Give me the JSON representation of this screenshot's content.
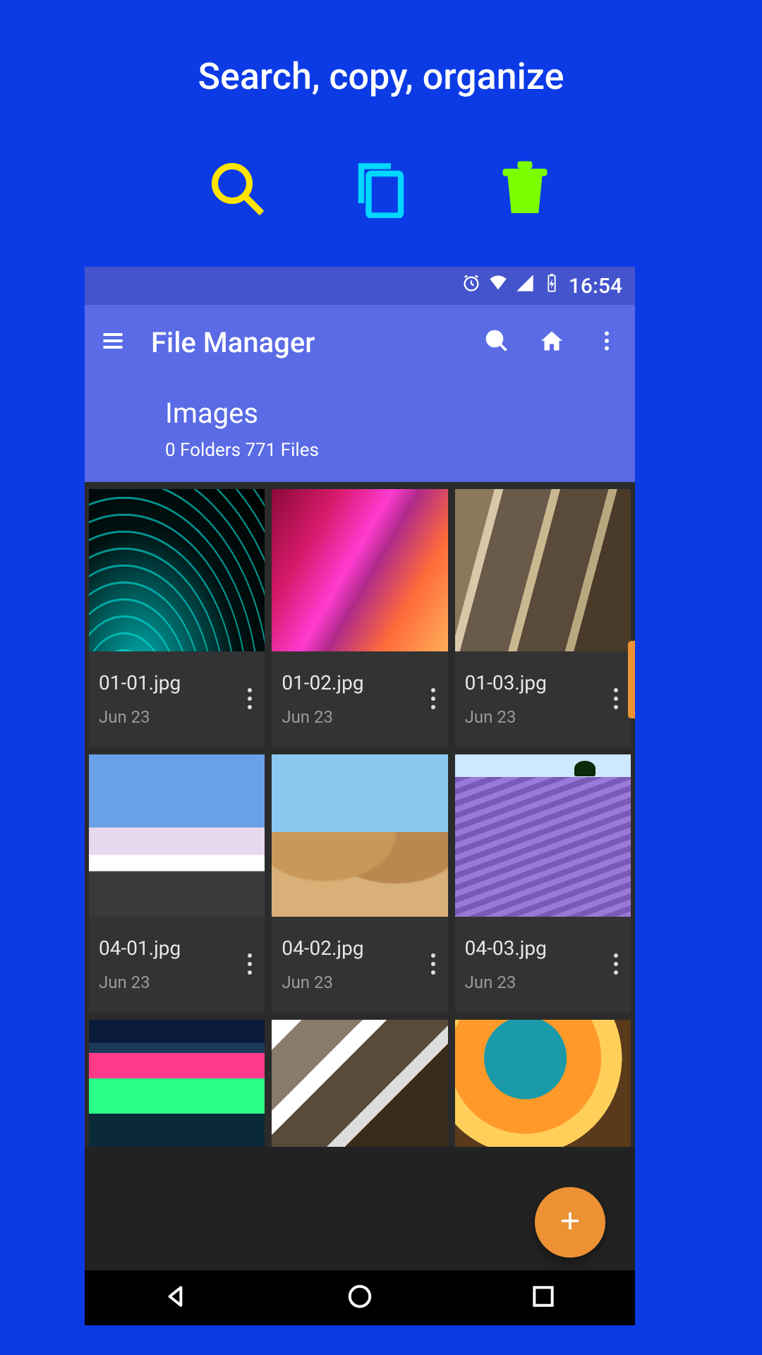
{
  "hero": {
    "title": "Search, copy, organize"
  },
  "statusbar": {
    "time": "16:54"
  },
  "appbar": {
    "title": "File Manager",
    "path_title": "Images",
    "path_sub": "0 Folders 771 Files"
  },
  "files": [
    {
      "name": "01-01.jpg",
      "date": "Jun 23"
    },
    {
      "name": "01-02.jpg",
      "date": "Jun 23"
    },
    {
      "name": "01-03.jpg",
      "date": "Jun 23"
    },
    {
      "name": "04-01.jpg",
      "date": "Jun 23"
    },
    {
      "name": "04-02.jpg",
      "date": "Jun 23"
    },
    {
      "name": "04-03.jpg",
      "date": "Jun 23"
    }
  ]
}
